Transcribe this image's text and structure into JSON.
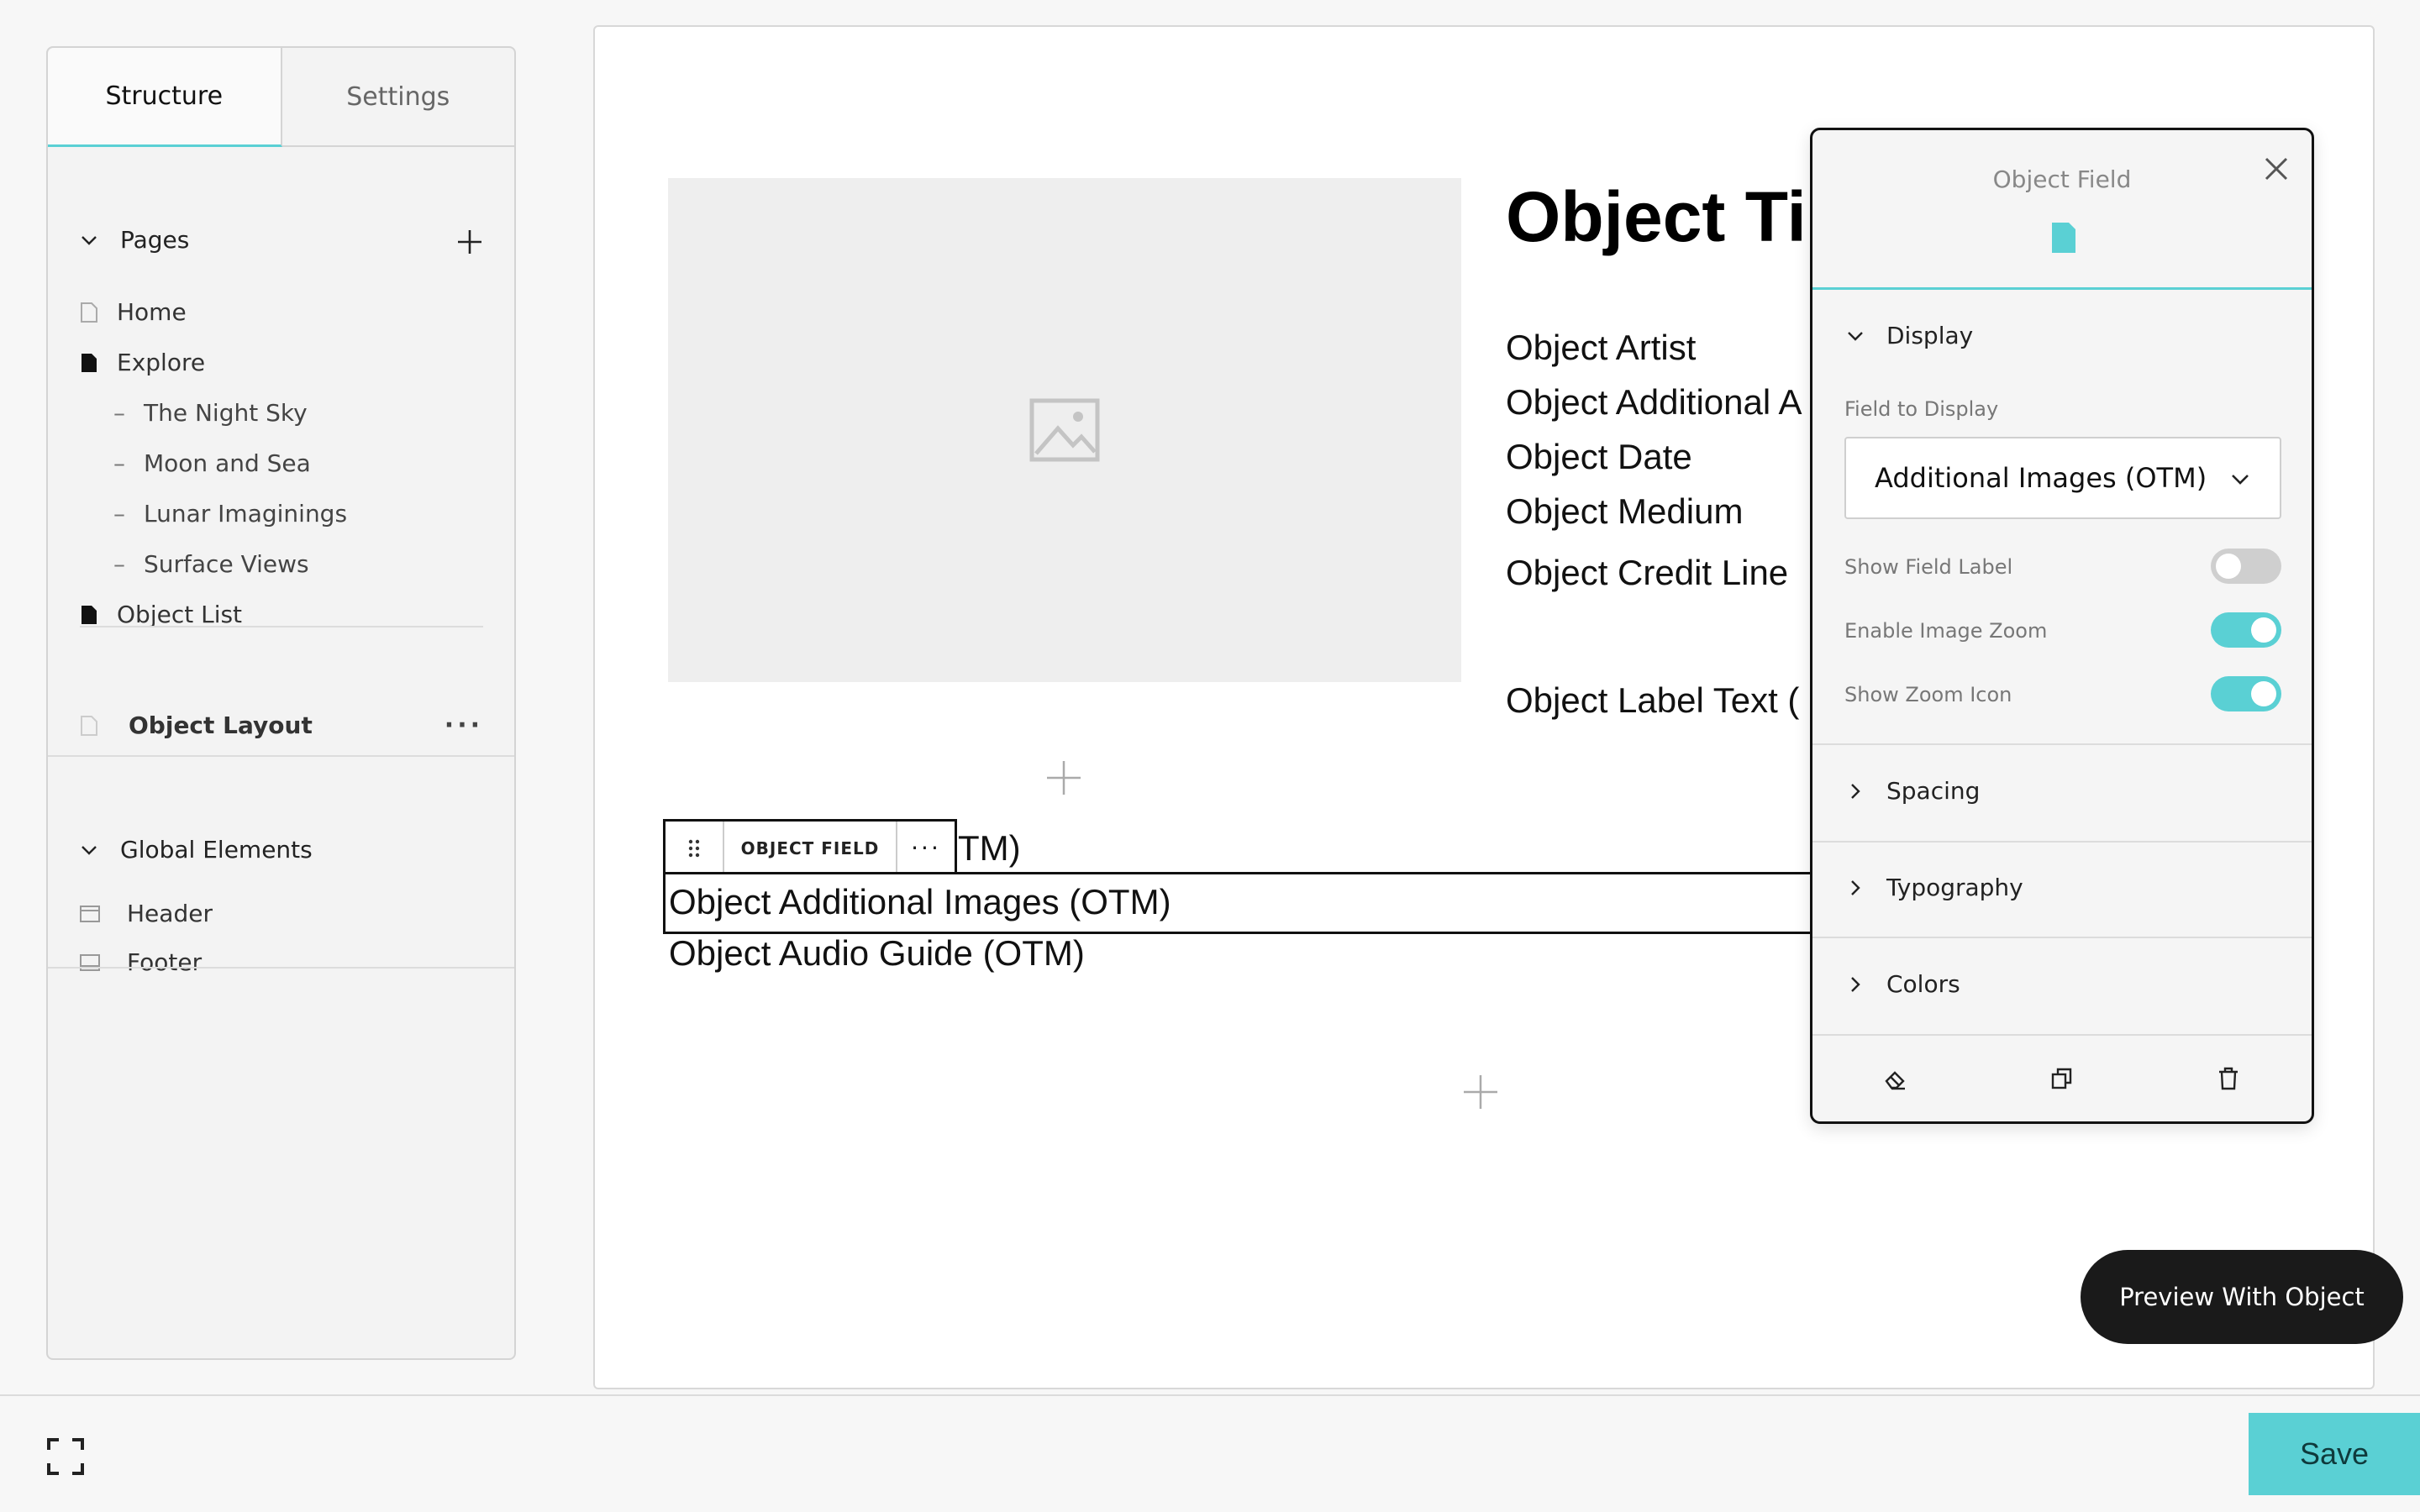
{
  "sidebar": {
    "tabs": [
      {
        "label": "Structure"
      },
      {
        "label": "Settings"
      }
    ],
    "pages_header": "Pages",
    "pages": [
      {
        "label": "Home"
      },
      {
        "label": "Explore"
      },
      {
        "label": "Object List"
      }
    ],
    "explore_children": [
      {
        "label": "The Night Sky"
      },
      {
        "label": "Moon and Sea"
      },
      {
        "label": "Lunar Imaginings"
      },
      {
        "label": "Surface Views"
      }
    ],
    "dash": "–",
    "object_layout": "Object Layout",
    "more_dots": "···",
    "global_header": "Global Elements",
    "global_items": [
      {
        "label": "Header"
      },
      {
        "label": "Footer"
      }
    ]
  },
  "canvas": {
    "title": "Object Ti",
    "lines": [
      {
        "text": "Object Artist"
      },
      {
        "text": "Object Additional A"
      },
      {
        "text": "Object Date"
      },
      {
        "text": "Object Medium"
      },
      {
        "text": "Object Credit Line"
      },
      {
        "text": "Object Label Text ("
      }
    ],
    "chip_label": "OBJECT FIELD",
    "chip_more": "···",
    "field_partial": "TM)",
    "field_selected": "Object Additional Images (OTM)",
    "field_next": "Object Audio Guide (OTM)"
  },
  "panel": {
    "title": "Object Field",
    "display_section": "Display",
    "field_to_display_label": "Field to Display",
    "field_to_display_value": "Additional Images (OTM)",
    "toggles": [
      {
        "label": "Show Field Label",
        "on": false
      },
      {
        "label": "Enable Image Zoom",
        "on": true
      },
      {
        "label": "Show Zoom Icon",
        "on": true
      }
    ],
    "sections": [
      {
        "label": "Spacing"
      },
      {
        "label": "Typography"
      },
      {
        "label": "Colors"
      }
    ],
    "accent_color": "#5ad0d4"
  },
  "preview_button": "Preview With Object",
  "save_button": "Save"
}
